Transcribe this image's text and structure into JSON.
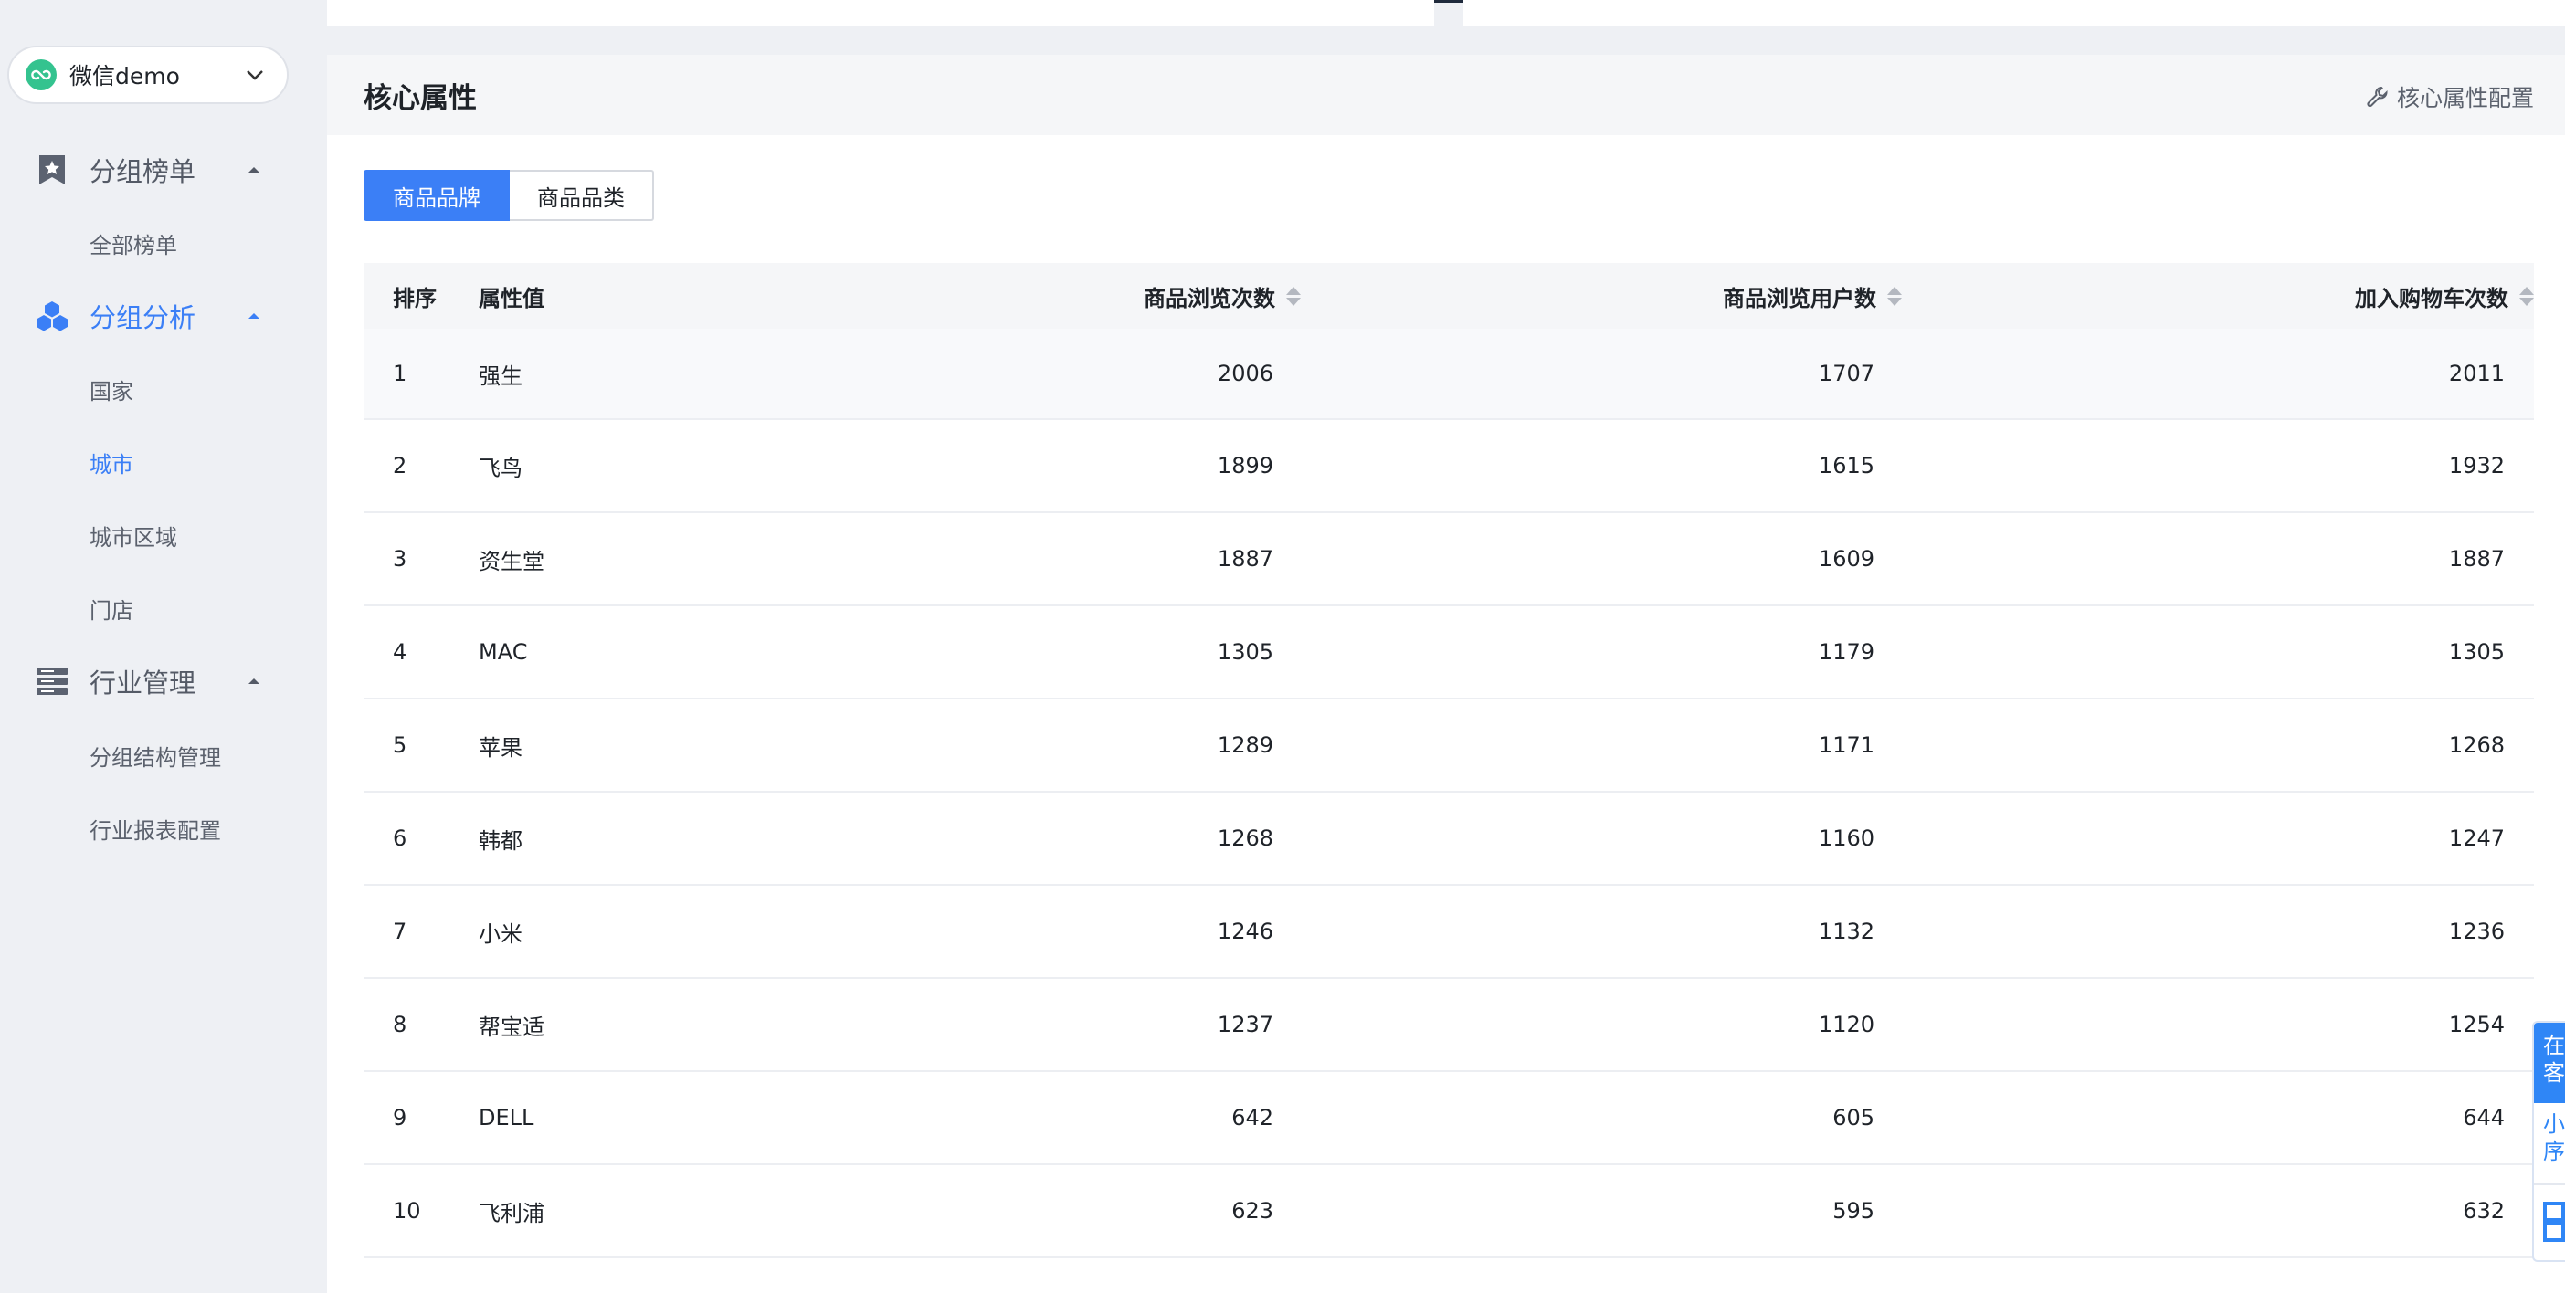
{
  "app_switcher": {
    "name": "微信demo"
  },
  "sidebar": {
    "groups": [
      {
        "label": "分组榜单",
        "icon": "star-bookmark-icon",
        "items": [
          {
            "label": "全部榜单"
          }
        ]
      },
      {
        "label": "分组分析",
        "icon": "cubes-icon",
        "items": [
          {
            "label": "国家"
          },
          {
            "label": "城市",
            "selected": true
          },
          {
            "label": "城市区域"
          },
          {
            "label": "门店"
          }
        ]
      },
      {
        "label": "行业管理",
        "icon": "server-stack-icon",
        "items": [
          {
            "label": "分组结构管理"
          },
          {
            "label": "行业报表配置"
          }
        ]
      }
    ]
  },
  "panel": {
    "title": "核心属性",
    "config_link": "核心属性配置",
    "tabs": [
      {
        "label": "商品品牌",
        "active": true
      },
      {
        "label": "商品品类",
        "active": false
      }
    ],
    "table": {
      "columns": [
        "排序",
        "属性值",
        "商品浏览次数",
        "商品浏览用户数",
        "加入购物车次数"
      ],
      "rows": [
        {
          "rank": "1",
          "value": "强生",
          "views": "2006",
          "users": "1707",
          "cart": "2011"
        },
        {
          "rank": "2",
          "value": "飞鸟",
          "views": "1899",
          "users": "1615",
          "cart": "1932"
        },
        {
          "rank": "3",
          "value": "资生堂",
          "views": "1887",
          "users": "1609",
          "cart": "1887"
        },
        {
          "rank": "4",
          "value": "MAC",
          "views": "1305",
          "users": "1179",
          "cart": "1305"
        },
        {
          "rank": "5",
          "value": "苹果",
          "views": "1289",
          "users": "1171",
          "cart": "1268"
        },
        {
          "rank": "6",
          "value": "韩都",
          "views": "1268",
          "users": "1160",
          "cart": "1247"
        },
        {
          "rank": "7",
          "value": "小米",
          "views": "1246",
          "users": "1132",
          "cart": "1236"
        },
        {
          "rank": "8",
          "value": "帮宝适",
          "views": "1237",
          "users": "1120",
          "cart": "1254"
        },
        {
          "rank": "9",
          "value": "DELL",
          "views": "642",
          "users": "605",
          "cart": "644"
        },
        {
          "rank": "10",
          "value": "飞利浦",
          "views": "623",
          "users": "595",
          "cart": "632"
        }
      ]
    }
  },
  "float_widget": {
    "top_text": "在客",
    "mid_text": "小序",
    "icon": "qrcode-icon"
  },
  "colors": {
    "accent": "#3b7ff6",
    "logo_green": "#34c38f",
    "sidebar_bg": "#eef0f4"
  }
}
